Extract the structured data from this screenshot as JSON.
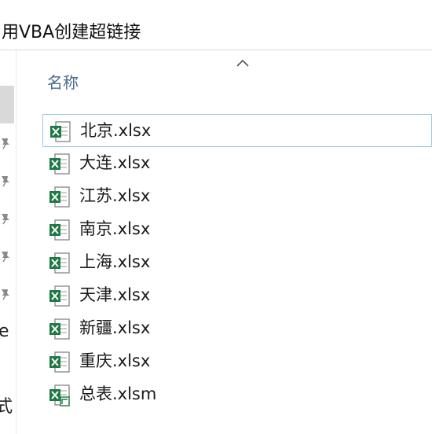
{
  "address": {
    "path": "用VBA创建超链接"
  },
  "header": {
    "name_column": "名称"
  },
  "nav": {
    "letters": [
      "e",
      "式"
    ]
  },
  "files": [
    {
      "name": "北京.xlsx",
      "type": "xlsx"
    },
    {
      "name": "大连.xlsx",
      "type": "xlsx"
    },
    {
      "name": "江苏.xlsx",
      "type": "xlsx"
    },
    {
      "name": "南京.xlsx",
      "type": "xlsx"
    },
    {
      "name": "上海.xlsx",
      "type": "xlsx"
    },
    {
      "name": "天津.xlsx",
      "type": "xlsx"
    },
    {
      "name": "新疆.xlsx",
      "type": "xlsx"
    },
    {
      "name": "重庆.xlsx",
      "type": "xlsx"
    },
    {
      "name": "总表.xlsm",
      "type": "xlsm"
    }
  ],
  "colors": {
    "excel_green": "#1d7a45",
    "header_text": "#4a6a8a",
    "selection_border": "#9cc7e6"
  }
}
